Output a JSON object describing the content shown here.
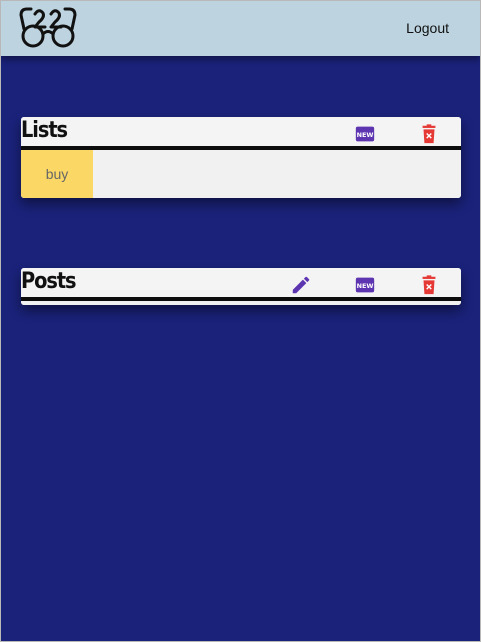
{
  "header": {
    "logout_label": "Logout"
  },
  "lists_section": {
    "title": "Lists",
    "items": [
      {
        "label": "buy"
      }
    ]
  },
  "posts_section": {
    "title": "Posts"
  },
  "icons": {
    "logo": "glasses-logo-icon",
    "edit": "pencil-icon",
    "new": "new-badge-icon",
    "delete": "trash-delete-icon"
  },
  "colors": {
    "background": "#1a227a",
    "header_bg": "#bdd4e0",
    "card_bg": "#f4f4f4",
    "list_item_bg": "#fbd866",
    "accent_purple": "#5e35b1",
    "delete_red": "#e53935"
  }
}
